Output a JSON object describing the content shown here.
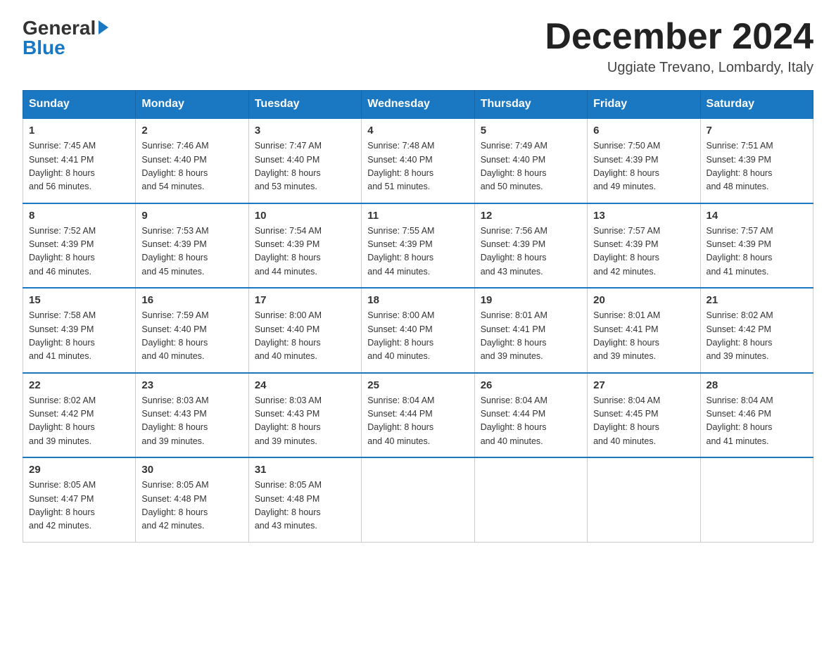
{
  "header": {
    "logo_general": "General",
    "logo_blue": "Blue",
    "month_title": "December 2024",
    "location": "Uggiate Trevano, Lombardy, Italy"
  },
  "weekdays": [
    "Sunday",
    "Monday",
    "Tuesday",
    "Wednesday",
    "Thursday",
    "Friday",
    "Saturday"
  ],
  "weeks": [
    [
      {
        "day": "1",
        "sunrise": "7:45 AM",
        "sunset": "4:41 PM",
        "daylight": "8 hours and 56 minutes."
      },
      {
        "day": "2",
        "sunrise": "7:46 AM",
        "sunset": "4:40 PM",
        "daylight": "8 hours and 54 minutes."
      },
      {
        "day": "3",
        "sunrise": "7:47 AM",
        "sunset": "4:40 PM",
        "daylight": "8 hours and 53 minutes."
      },
      {
        "day": "4",
        "sunrise": "7:48 AM",
        "sunset": "4:40 PM",
        "daylight": "8 hours and 51 minutes."
      },
      {
        "day": "5",
        "sunrise": "7:49 AM",
        "sunset": "4:40 PM",
        "daylight": "8 hours and 50 minutes."
      },
      {
        "day": "6",
        "sunrise": "7:50 AM",
        "sunset": "4:39 PM",
        "daylight": "8 hours and 49 minutes."
      },
      {
        "day": "7",
        "sunrise": "7:51 AM",
        "sunset": "4:39 PM",
        "daylight": "8 hours and 48 minutes."
      }
    ],
    [
      {
        "day": "8",
        "sunrise": "7:52 AM",
        "sunset": "4:39 PM",
        "daylight": "8 hours and 46 minutes."
      },
      {
        "day": "9",
        "sunrise": "7:53 AM",
        "sunset": "4:39 PM",
        "daylight": "8 hours and 45 minutes."
      },
      {
        "day": "10",
        "sunrise": "7:54 AM",
        "sunset": "4:39 PM",
        "daylight": "8 hours and 44 minutes."
      },
      {
        "day": "11",
        "sunrise": "7:55 AM",
        "sunset": "4:39 PM",
        "daylight": "8 hours and 44 minutes."
      },
      {
        "day": "12",
        "sunrise": "7:56 AM",
        "sunset": "4:39 PM",
        "daylight": "8 hours and 43 minutes."
      },
      {
        "day": "13",
        "sunrise": "7:57 AM",
        "sunset": "4:39 PM",
        "daylight": "8 hours and 42 minutes."
      },
      {
        "day": "14",
        "sunrise": "7:57 AM",
        "sunset": "4:39 PM",
        "daylight": "8 hours and 41 minutes."
      }
    ],
    [
      {
        "day": "15",
        "sunrise": "7:58 AM",
        "sunset": "4:39 PM",
        "daylight": "8 hours and 41 minutes."
      },
      {
        "day": "16",
        "sunrise": "7:59 AM",
        "sunset": "4:40 PM",
        "daylight": "8 hours and 40 minutes."
      },
      {
        "day": "17",
        "sunrise": "8:00 AM",
        "sunset": "4:40 PM",
        "daylight": "8 hours and 40 minutes."
      },
      {
        "day": "18",
        "sunrise": "8:00 AM",
        "sunset": "4:40 PM",
        "daylight": "8 hours and 40 minutes."
      },
      {
        "day": "19",
        "sunrise": "8:01 AM",
        "sunset": "4:41 PM",
        "daylight": "8 hours and 39 minutes."
      },
      {
        "day": "20",
        "sunrise": "8:01 AM",
        "sunset": "4:41 PM",
        "daylight": "8 hours and 39 minutes."
      },
      {
        "day": "21",
        "sunrise": "8:02 AM",
        "sunset": "4:42 PM",
        "daylight": "8 hours and 39 minutes."
      }
    ],
    [
      {
        "day": "22",
        "sunrise": "8:02 AM",
        "sunset": "4:42 PM",
        "daylight": "8 hours and 39 minutes."
      },
      {
        "day": "23",
        "sunrise": "8:03 AM",
        "sunset": "4:43 PM",
        "daylight": "8 hours and 39 minutes."
      },
      {
        "day": "24",
        "sunrise": "8:03 AM",
        "sunset": "4:43 PM",
        "daylight": "8 hours and 39 minutes."
      },
      {
        "day": "25",
        "sunrise": "8:04 AM",
        "sunset": "4:44 PM",
        "daylight": "8 hours and 40 minutes."
      },
      {
        "day": "26",
        "sunrise": "8:04 AM",
        "sunset": "4:44 PM",
        "daylight": "8 hours and 40 minutes."
      },
      {
        "day": "27",
        "sunrise": "8:04 AM",
        "sunset": "4:45 PM",
        "daylight": "8 hours and 40 minutes."
      },
      {
        "day": "28",
        "sunrise": "8:04 AM",
        "sunset": "4:46 PM",
        "daylight": "8 hours and 41 minutes."
      }
    ],
    [
      {
        "day": "29",
        "sunrise": "8:05 AM",
        "sunset": "4:47 PM",
        "daylight": "8 hours and 42 minutes."
      },
      {
        "day": "30",
        "sunrise": "8:05 AM",
        "sunset": "4:48 PM",
        "daylight": "8 hours and 42 minutes."
      },
      {
        "day": "31",
        "sunrise": "8:05 AM",
        "sunset": "4:48 PM",
        "daylight": "8 hours and 43 minutes."
      },
      null,
      null,
      null,
      null
    ]
  ],
  "labels": {
    "sunrise": "Sunrise:",
    "sunset": "Sunset:",
    "daylight": "Daylight:"
  }
}
